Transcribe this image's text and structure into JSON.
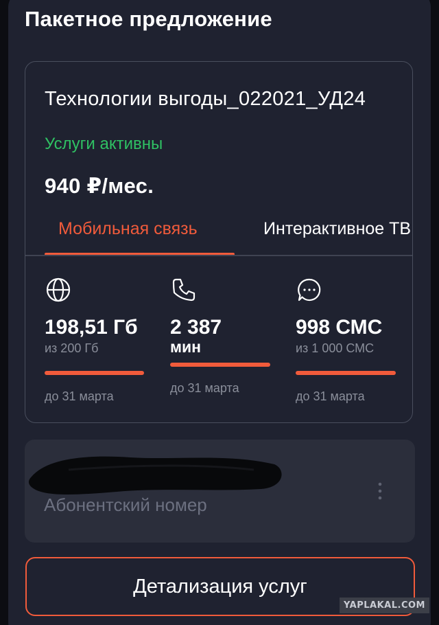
{
  "section": {
    "title": "Пакетное предложение"
  },
  "tariff": {
    "name": "Технологии выгоды_022021_УД24",
    "status": "Услуги активны",
    "status_color": "#2fc163",
    "price": "940 ₽/мес."
  },
  "tabs": [
    {
      "label": "Мобильная связь",
      "active": true
    },
    {
      "label": "Интерактивное ТВ",
      "active": false
    }
  ],
  "accent_color": "#f15b3b",
  "stats": [
    {
      "icon": "globe-icon",
      "value": "198,51 Гб",
      "sub": "из 200 Гб",
      "remaining_fraction": 0.99,
      "until": "до 31 марта"
    },
    {
      "icon": "phone-icon",
      "value": "2 387",
      "sub": "мин",
      "remaining_fraction": 1.0,
      "until": "до 31 марта"
    },
    {
      "icon": "chat-icon",
      "value": "998 СМС",
      "sub": "из 1 000 СМС",
      "remaining_fraction": 0.998,
      "until": "до 31 марта"
    }
  ],
  "subscriber": {
    "label": "Абонентский номер",
    "menu_icon": "kebab-menu-icon"
  },
  "details_button": {
    "label": "Детализация услуг"
  },
  "watermark": {
    "text": "YAPLAKAL.COM"
  }
}
